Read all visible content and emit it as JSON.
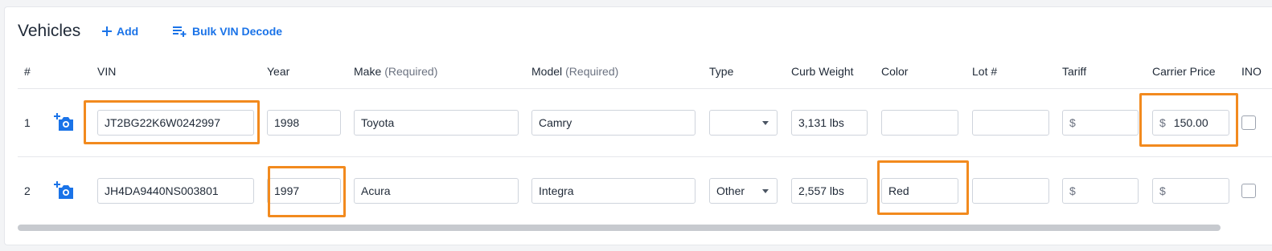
{
  "header": {
    "title": "Vehicles",
    "add_label": "Add",
    "bulk_label": "Bulk VIN Decode"
  },
  "columns": {
    "num": "#",
    "vin": "VIN",
    "year": "Year",
    "make": "Make",
    "make_req": "(Required)",
    "model": "Model",
    "model_req": "(Required)",
    "type": "Type",
    "curb_weight": "Curb Weight",
    "color": "Color",
    "lot": "Lot #",
    "tariff": "Tariff",
    "carrier_price": "Carrier Price",
    "inop": "INO"
  },
  "currency_symbol": "$",
  "rows": [
    {
      "num": "1",
      "vin": "JT2BG22K6W0242997",
      "year": "1998",
      "make": "Toyota",
      "model": "Camry",
      "type": "",
      "curb_weight": "3,131 lbs",
      "color": "",
      "lot": "",
      "tariff": "",
      "carrier_price": "150.00",
      "inop": false
    },
    {
      "num": "2",
      "vin": "JH4DA9440NS003801",
      "year": "1997",
      "make": "Acura",
      "model": "Integra",
      "type": "Other",
      "curb_weight": "2,557 lbs",
      "color": "Red",
      "lot": "",
      "tariff": "",
      "carrier_price": "",
      "inop": false
    }
  ],
  "colors": {
    "accent": "#1a73e8",
    "highlight": "#f28a1e"
  },
  "icons": {
    "add": "plus-icon",
    "bulk": "playlist-add-icon",
    "camera": "add-photo-camera-icon"
  }
}
